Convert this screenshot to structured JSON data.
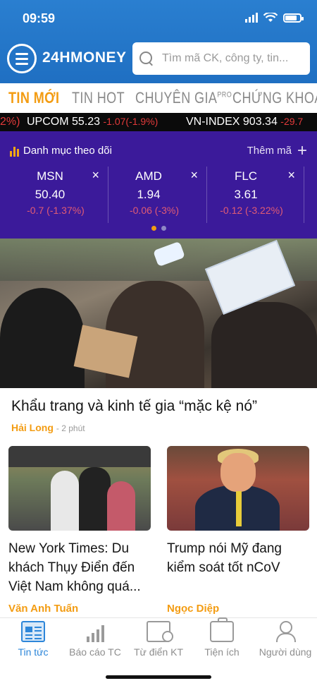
{
  "status_bar": {
    "time": "09:59"
  },
  "header": {
    "logo": "24HMONEY",
    "search_placeholder": "Tìm mã CK, công ty, tin..."
  },
  "tabs": [
    {
      "label": "TIN MỚI",
      "active": true
    },
    {
      "label": "TIN HOT",
      "active": false
    },
    {
      "label": "CHUYÊN GIA",
      "sup": "PRO",
      "active": false
    },
    {
      "label": "CHỨNG KHOÁN",
      "active": false
    }
  ],
  "ticker": {
    "lead_change": "2%)",
    "items": [
      {
        "name": "UPCOM",
        "value": "55.23",
        "change": "-1.07(-1.9%)"
      },
      {
        "name": "VN-INDEX",
        "value": "903.34",
        "change": "-29.7"
      }
    ]
  },
  "watchlist": {
    "title": "Danh mục theo dõi",
    "add_label": "Thêm mã",
    "stocks": [
      {
        "symbol": "MSN",
        "price": "50.40",
        "change": "-0.7 (-1.37%)"
      },
      {
        "symbol": "AMD",
        "price": "1.94",
        "change": "-0.06 (-3%)"
      },
      {
        "symbol": "FLC",
        "price": "3.61",
        "change": "-0.12 (-3.22%)"
      }
    ],
    "close_glyph": "×",
    "page_active": 1,
    "page_count": 2,
    "accent_color": "#f39c12",
    "bg_color": "#3b1a9a"
  },
  "featured": {
    "headline": "Khẩu trang và kinh tế gia “mặc kệ nó”",
    "author": "Hải Long",
    "ago": "- 2 phút"
  },
  "cards": [
    {
      "title": "New York Times: Du khách Thụy Điển đến Việt Nam không quá...",
      "author": "Văn Anh Tuấn"
    },
    {
      "title": "Trump nói Mỹ đang kiểm soát tốt nCoV",
      "author": "Ngọc Diệp"
    }
  ],
  "bottom_nav": [
    {
      "label": "Tin tức",
      "icon": "newspaper-icon",
      "active": true
    },
    {
      "label": "Báo cáo TC",
      "icon": "bar-chart-icon",
      "active": false
    },
    {
      "label": "Từ điển KT",
      "icon": "dictionary-icon",
      "active": false
    },
    {
      "label": "Tiện ích",
      "icon": "briefcase-icon",
      "active": false
    },
    {
      "label": "Người dùng",
      "icon": "user-icon",
      "active": false
    }
  ],
  "colors": {
    "brand_blue": "#1f6fc2",
    "accent_orange": "#f39c12",
    "negative_red": "#e23a3a",
    "active_blue": "#2d86d9"
  }
}
